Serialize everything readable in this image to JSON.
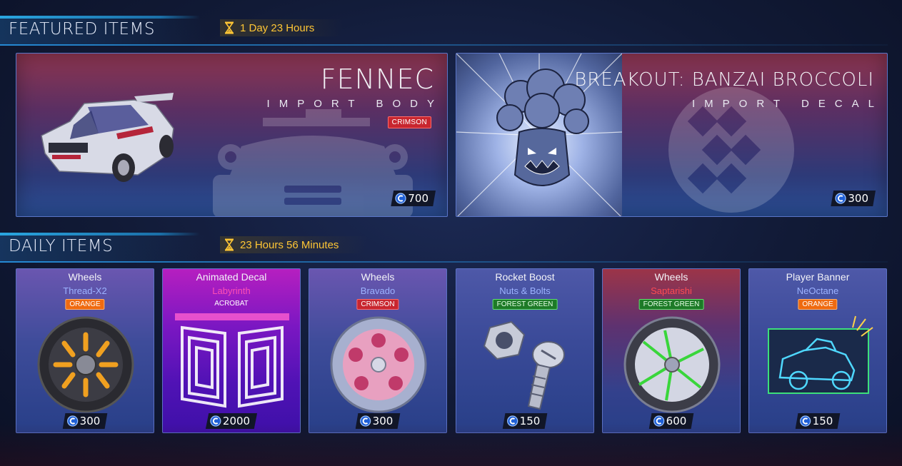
{
  "featured_section": {
    "title": "FEATURED ITEMS",
    "timer": "1 Day 23 Hours"
  },
  "featured": [
    {
      "name": "FENNEC",
      "type": "IMPORT BODY",
      "paint": "CRIMSON",
      "price": "700"
    },
    {
      "name": "BREAKOUT: BANZAI BROCCOLI",
      "type": "IMPORT DECAL",
      "price": "300"
    }
  ],
  "daily_section": {
    "title": "DAILY ITEMS",
    "timer": "23 Hours 56 Minutes"
  },
  "daily": [
    {
      "type": "Wheels",
      "name": "Thread-X2",
      "badge": "ORANGE",
      "price": "300",
      "name_color": "#9cb2ff"
    },
    {
      "type": "Animated Decal",
      "name": "Labyrinth",
      "badge": "ACROBAT",
      "price": "2000",
      "name_color": "#ff4fb4"
    },
    {
      "type": "Wheels",
      "name": "Bravado",
      "badge": "CRIMSON",
      "price": "300",
      "name_color": "#9cb2ff"
    },
    {
      "type": "Rocket Boost",
      "name": "Nuts & Bolts",
      "badge": "FOREST GREEN",
      "price": "150",
      "name_color": "#9cb2ff"
    },
    {
      "type": "Wheels",
      "name": "Saptarishi",
      "badge": "FOREST GREEN",
      "price": "600",
      "name_color": "#ff4b52"
    },
    {
      "type": "Player Banner",
      "name": "NeOctane",
      "badge": "ORANGE",
      "price": "150",
      "name_color": "#9cb2ff"
    }
  ],
  "icons": {
    "timer": "hourglass-icon",
    "currency": "credits-icon"
  },
  "colors": {
    "accent_blue": "#2aa6e0",
    "timer_gold": "#ffc635",
    "crimson": "#c8262f",
    "orange": "#ef6a10",
    "forest_green": "#1d7a27"
  }
}
